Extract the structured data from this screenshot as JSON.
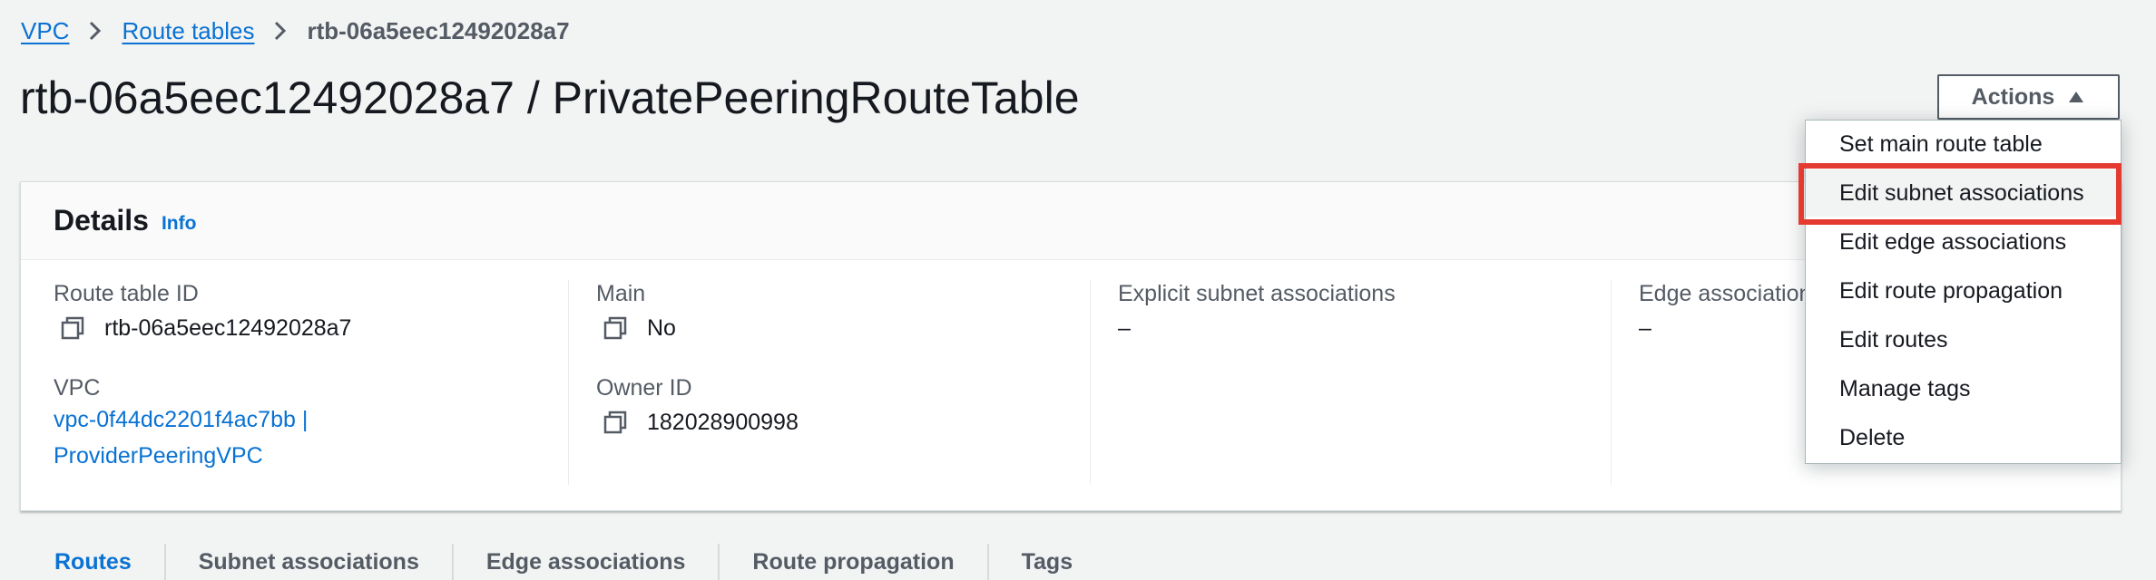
{
  "breadcrumb": {
    "items": [
      "VPC",
      "Route tables"
    ],
    "current": "rtb-06a5eec12492028a7"
  },
  "header": {
    "title": "rtb-06a5eec12492028a7 / PrivatePeeringRouteTable",
    "actions_label": "Actions"
  },
  "details": {
    "title": "Details",
    "info": "Info",
    "route_table_id_label": "Route table ID",
    "route_table_id": "rtb-06a5eec12492028a7",
    "vpc_label": "VPC",
    "vpc_line1": "vpc-0f44dc2201f4ac7bb |",
    "vpc_line2": "ProviderPeeringVPC",
    "main_label": "Main",
    "main_value": "No",
    "owner_id_label": "Owner ID",
    "owner_id": "182028900998",
    "explicit_label": "Explicit subnet associations",
    "explicit_value": "–",
    "edge_label": "Edge associations",
    "edge_value": "–"
  },
  "tabs": [
    "Routes",
    "Subnet associations",
    "Edge associations",
    "Route propagation",
    "Tags"
  ],
  "menu": {
    "items": [
      "Set main route table",
      "Edit subnet associations",
      "Edit edge associations",
      "Edit route propagation",
      "Edit routes",
      "Manage tags",
      "Delete"
    ],
    "highlighted": "Edit subnet associations"
  },
  "colors": {
    "link": "#0972d3",
    "highlight": "#e53a2f"
  }
}
